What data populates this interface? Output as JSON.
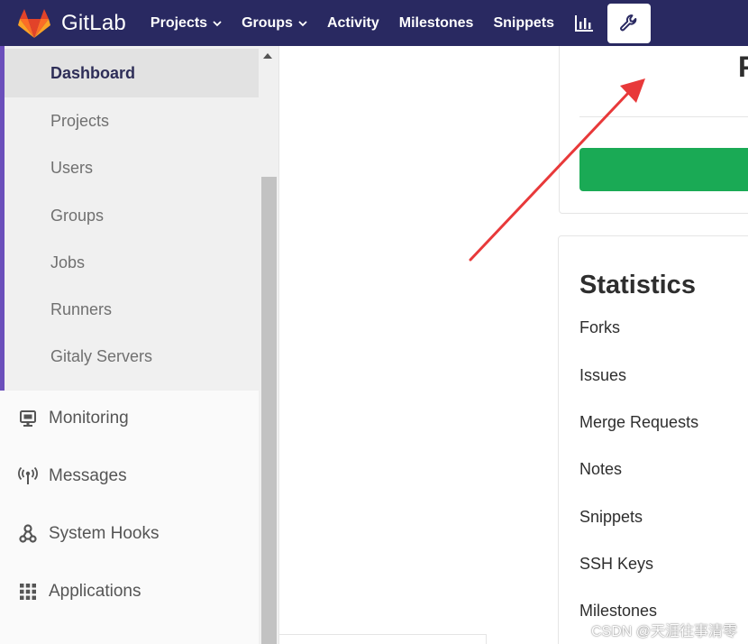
{
  "brand": {
    "name": "GitLab",
    "logo_icon": "gitlab-tanuki-icon"
  },
  "topnav": {
    "items": [
      {
        "label": "Projects",
        "dropdown": true
      },
      {
        "label": "Groups",
        "dropdown": true
      },
      {
        "label": "Activity",
        "dropdown": false
      },
      {
        "label": "Milestones",
        "dropdown": false
      },
      {
        "label": "Snippets",
        "dropdown": false
      }
    ],
    "icons": [
      "chart-bar-icon",
      "wrench-icon"
    ]
  },
  "sidebar": {
    "overview_items": [
      {
        "label": "Dashboard",
        "active": true
      },
      {
        "label": "Projects",
        "active": false
      },
      {
        "label": "Users",
        "active": false
      },
      {
        "label": "Groups",
        "active": false
      },
      {
        "label": "Jobs",
        "active": false
      },
      {
        "label": "Runners",
        "active": false
      },
      {
        "label": "Gitaly Servers",
        "active": false
      }
    ],
    "items": [
      {
        "label": "Monitoring",
        "icon": "monitor-icon"
      },
      {
        "label": "Messages",
        "icon": "broadcast-icon"
      },
      {
        "label": "System Hooks",
        "icon": "hook-icon"
      },
      {
        "label": "Applications",
        "icon": "grid-icon"
      }
    ]
  },
  "main": {
    "top_card_heading": "P",
    "statistics": {
      "title": "Statistics",
      "rows": [
        "Forks",
        "Issues",
        "Merge Requests",
        "Notes",
        "Snippets",
        "SSH Keys",
        "Milestones"
      ]
    }
  },
  "watermark": "CSDN @天涯往事清零",
  "colors": {
    "navbar": "#292961",
    "accent": "#6b4fbb",
    "green_button": "#1aaa55",
    "annotation_arrow": "#e8393a"
  }
}
